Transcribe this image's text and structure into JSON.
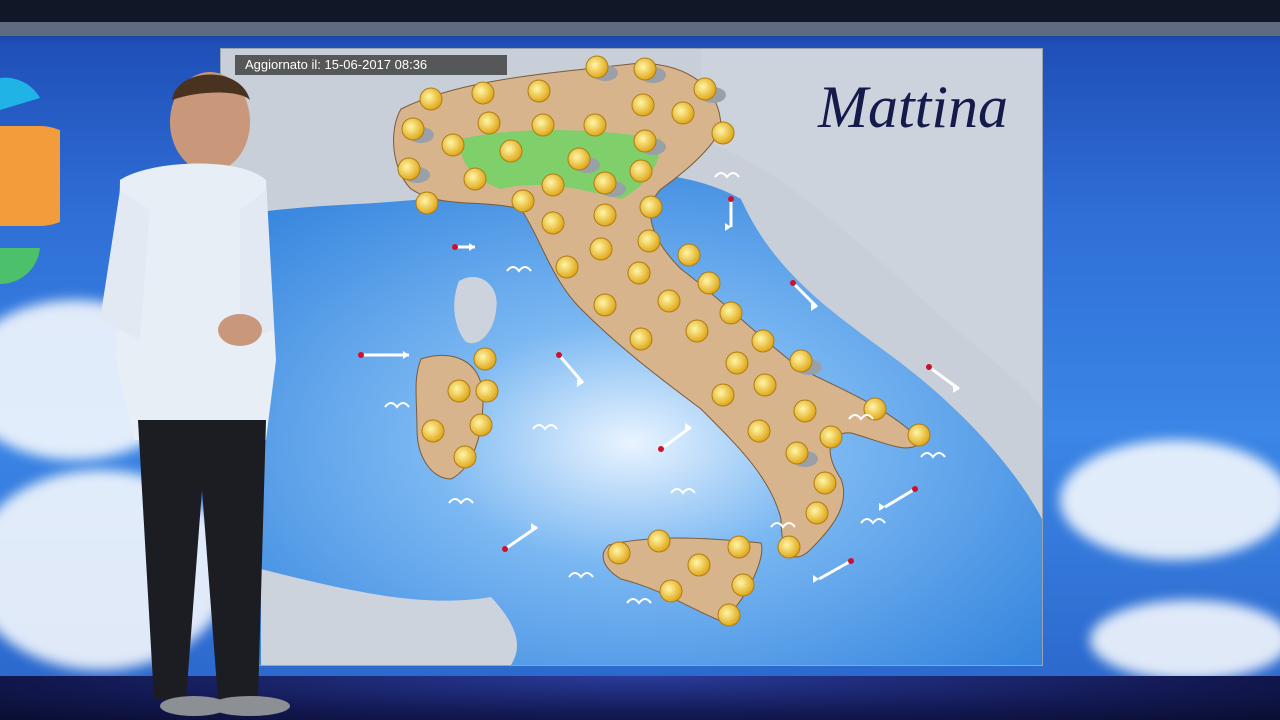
{
  "broadcast": {
    "updated_label": "Aggiornato il:",
    "updated_value": "15-06-2017 08:36",
    "period_label": "Mattina"
  },
  "map": {
    "region": "Italia",
    "icon_legend": {
      "sun": "sun-icon",
      "sun_cloud": "sun-cloud-icon",
      "wind": "wind-arrow-icon",
      "wave": "wave-icon"
    }
  },
  "colors": {
    "sea": "#3a8ee6",
    "land_plain": "#d9b48a",
    "land_green": "#7fcf6a",
    "foreign_land": "#c9cfd8",
    "title_text": "#141a4a"
  }
}
